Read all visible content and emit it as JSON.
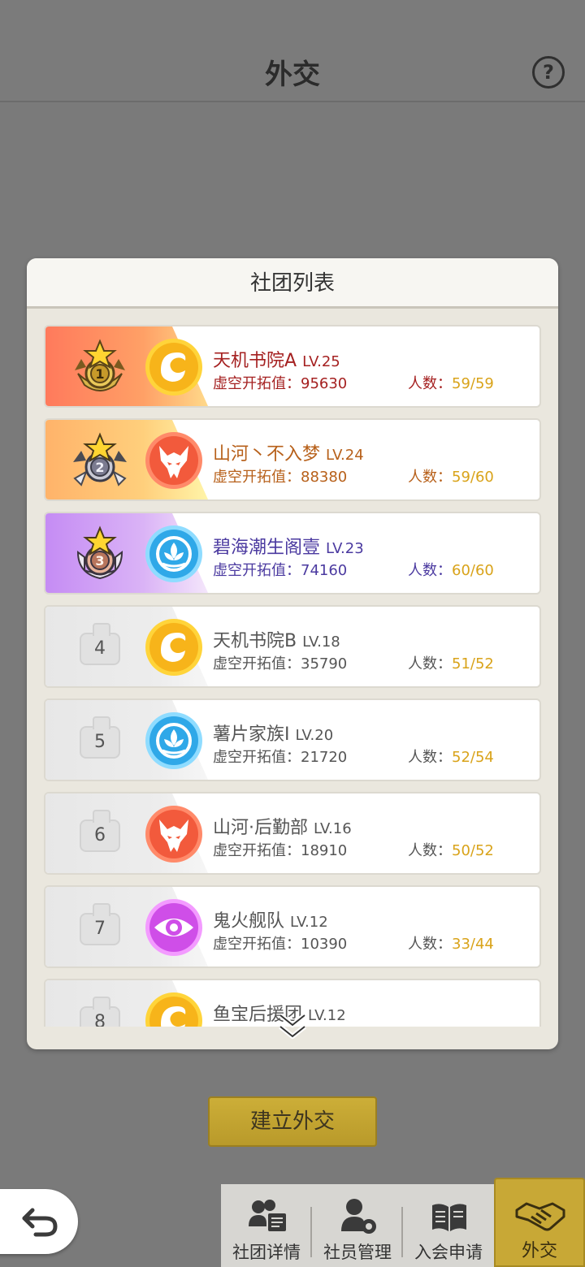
{
  "header": {
    "title": "外交",
    "help_label": "?"
  },
  "modal": {
    "title": "社团列表",
    "score_label": "虚空开拓值：",
    "members_label": "人数："
  },
  "clubs": [
    {
      "rank": "1",
      "name": "天机书院A",
      "level": "LV.25",
      "score": "95630",
      "members": "59/59",
      "emblem": "orange-swirl-emblem"
    },
    {
      "rank": "2",
      "name": "山河丶不入梦",
      "level": "LV.24",
      "score": "88380",
      "members": "59/60",
      "emblem": "red-dragon-emblem"
    },
    {
      "rank": "3",
      "name": "碧海潮生阁壹",
      "level": "LV.23",
      "score": "74160",
      "members": "60/60",
      "emblem": "blue-lotus-emblem"
    },
    {
      "rank": "4",
      "name": "天机书院B",
      "level": "LV.18",
      "score": "35790",
      "members": "51/52",
      "emblem": "orange-swirl-emblem"
    },
    {
      "rank": "5",
      "name": "薯片家族I",
      "level": "LV.20",
      "score": "21720",
      "members": "52/54",
      "emblem": "blue-lotus-emblem"
    },
    {
      "rank": "6",
      "name": "山河·后勤部",
      "level": "LV.16",
      "score": "18910",
      "members": "50/52",
      "emblem": "red-dragon-emblem"
    },
    {
      "rank": "7",
      "name": "鬼火舰队",
      "level": "LV.12",
      "score": "10390",
      "members": "33/44",
      "emblem": "purple-eye-emblem"
    },
    {
      "rank": "8",
      "name": "鱼宝后援团",
      "level": "LV.12",
      "score": "",
      "members": "",
      "emblem": "orange-swirl-emblem"
    }
  ],
  "actions": {
    "create_label": "建立外交"
  },
  "nav": {
    "tabs": [
      {
        "label": "社团详情",
        "icon": "club-details-icon"
      },
      {
        "label": "社员管理",
        "icon": "member-manage-icon"
      },
      {
        "label": "入会申请",
        "icon": "join-request-icon"
      },
      {
        "label": "外交",
        "icon": "diplomacy-handshake-icon",
        "active": true
      }
    ]
  },
  "colors": {
    "accent_gold": "#c8a836",
    "rank1_text": "#a52121",
    "rank2_text": "#b7601a",
    "rank3_text": "#4b3aa0",
    "members_value": "#d9a31a"
  }
}
